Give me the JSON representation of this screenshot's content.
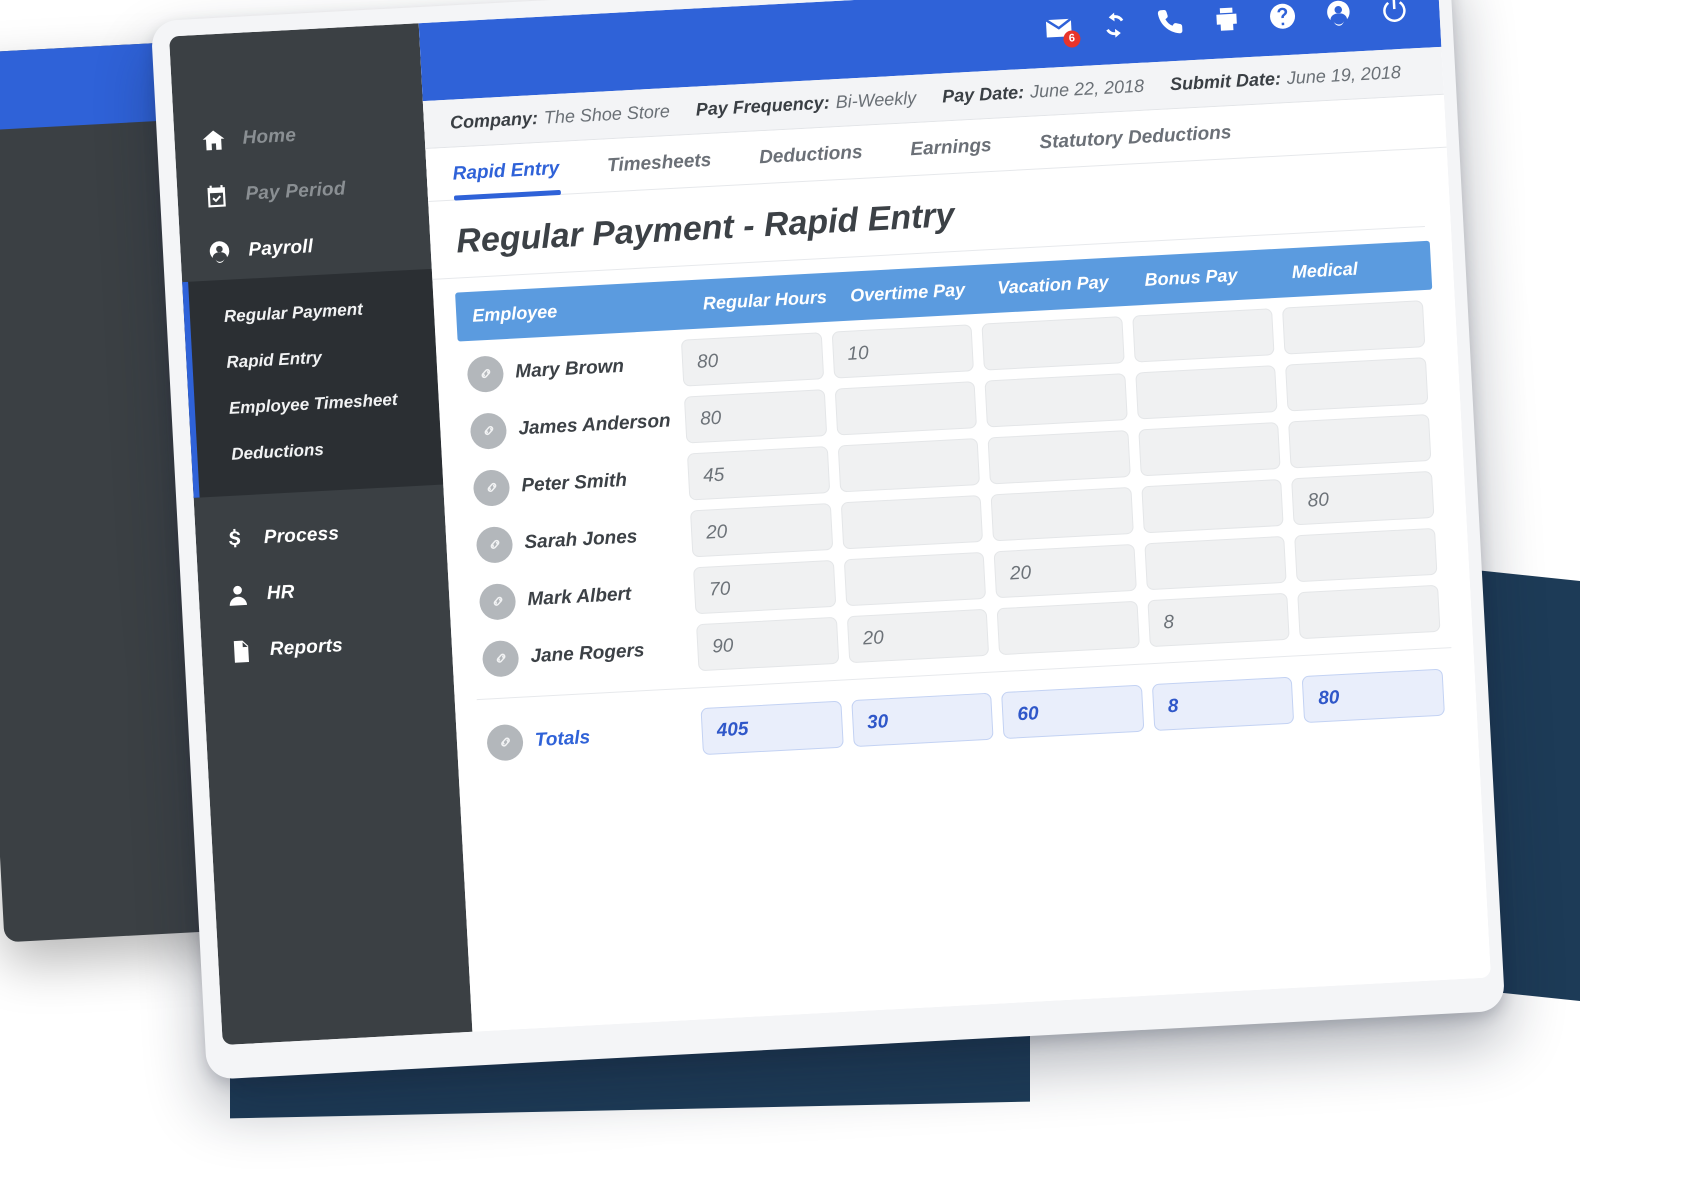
{
  "background": {
    "accent_navy": "#1d3b57",
    "card_dark": "#3b4044",
    "brand_blue": "#2f62d8"
  },
  "topbar": {
    "icons": [
      {
        "name": "mail-icon",
        "label": "Messages",
        "badge": "6"
      },
      {
        "name": "refresh-icon",
        "label": "Refresh",
        "badge": ""
      },
      {
        "name": "phone-icon",
        "label": "Call",
        "badge": ""
      },
      {
        "name": "print-icon",
        "label": "Print",
        "badge": ""
      },
      {
        "name": "help-icon",
        "label": "Help",
        "badge": ""
      },
      {
        "name": "user-icon",
        "label": "Account",
        "badge": ""
      },
      {
        "name": "power-icon",
        "label": "Log out",
        "badge": ""
      }
    ]
  },
  "sidebar": {
    "items": [
      {
        "label": "Home",
        "icon": "home-icon",
        "state": "dim"
      },
      {
        "label": "Pay Period",
        "icon": "calendar-check-icon",
        "state": "dim"
      },
      {
        "label": "Payroll",
        "icon": "user-badge-icon",
        "state": "active"
      }
    ],
    "submenu": [
      {
        "label": "Regular Payment"
      },
      {
        "label": "Rapid Entry"
      },
      {
        "label": "Employee Timesheet"
      },
      {
        "label": "Deductions"
      }
    ],
    "lower_items": [
      {
        "label": "Process",
        "icon": "dollar-icon"
      },
      {
        "label": "HR",
        "icon": "person-icon"
      },
      {
        "label": "Reports",
        "icon": "document-icon"
      }
    ]
  },
  "infobar": [
    {
      "label": "Company:",
      "value": "The Shoe Store"
    },
    {
      "label": "Pay Frequency:",
      "value": "Bi-Weekly"
    },
    {
      "label": "Pay Date:",
      "value": "June 22, 2018"
    },
    {
      "label": "Submit Date:",
      "value": "June 19, 2018"
    }
  ],
  "tabs": [
    {
      "label": "Rapid Entry",
      "active": true
    },
    {
      "label": "Timesheets",
      "active": false
    },
    {
      "label": "Deductions",
      "active": false
    },
    {
      "label": "Earnings",
      "active": false
    },
    {
      "label": "Statutory Deductions",
      "active": false
    }
  ],
  "page_title": "Regular Payment - Rapid Entry",
  "table": {
    "columns": [
      "Employee",
      "Regular Hours",
      "Overtime Pay",
      "Vacation Pay",
      "Bonus Pay",
      "Medical"
    ],
    "rows": [
      {
        "employee": "Mary Brown",
        "regular_hours": "80",
        "overtime_pay": "10",
        "vacation_pay": "",
        "bonus_pay": "",
        "medical": ""
      },
      {
        "employee": "James Anderson",
        "regular_hours": "80",
        "overtime_pay": "",
        "vacation_pay": "",
        "bonus_pay": "",
        "medical": ""
      },
      {
        "employee": "Peter Smith",
        "regular_hours": "45",
        "overtime_pay": "",
        "vacation_pay": "",
        "bonus_pay": "",
        "medical": ""
      },
      {
        "employee": "Sarah Jones",
        "regular_hours": "20",
        "overtime_pay": "",
        "vacation_pay": "",
        "bonus_pay": "",
        "medical": "80"
      },
      {
        "employee": "Mark Albert",
        "regular_hours": "70",
        "overtime_pay": "",
        "vacation_pay": "20",
        "bonus_pay": "",
        "medical": ""
      },
      {
        "employee": "Jane Rogers",
        "regular_hours": "90",
        "overtime_pay": "20",
        "vacation_pay": "",
        "bonus_pay": "8",
        "medical": ""
      }
    ],
    "totals": {
      "label": "Totals",
      "regular_hours": "405",
      "overtime_pay": "30",
      "vacation_pay": "60",
      "bonus_pay": "8",
      "medical": "80"
    }
  }
}
